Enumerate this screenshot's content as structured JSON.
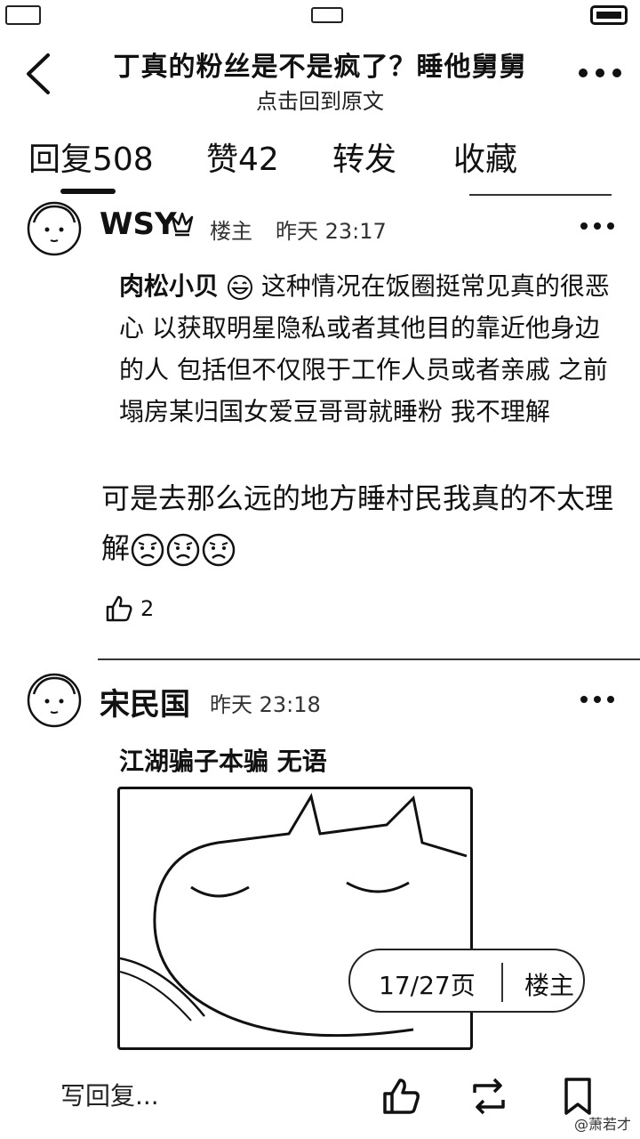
{
  "header": {
    "title": "丁真的粉丝是不是疯了？睡他舅舅",
    "subtitle": "点击回到原文"
  },
  "tabs": [
    {
      "label": "回复508"
    },
    {
      "label": "赞42"
    },
    {
      "label": "转发"
    },
    {
      "label": "收藏"
    }
  ],
  "post1": {
    "username": "WSY",
    "role": "楼主",
    "time": "昨天 23:17",
    "quote_name": "肉松小贝",
    "quote_text": " 这种情况在饭圈挺常见真的很恶心 以获取明星隐私或者其他目的靠近他身边的人 包括但不仅限于工作人员或者亲戚 之前塌房某归国女爱豆哥哥就睡粉 我不理解",
    "reply_text": "可是去那么远的地方睡村民我真的不太理解",
    "likes": "2"
  },
  "post2": {
    "username": "宋民国",
    "time": "昨天 23:18",
    "quote_text": "江湖骗子本骗 无语"
  },
  "pager": {
    "page": "17/27页",
    "owner": "楼主"
  },
  "bottom": {
    "reply_placeholder": "写回复..."
  },
  "watermark": "@萧若才",
  "icons": [
    "back-icon",
    "more-icon",
    "crown-icon",
    "grin-emoji",
    "sad-emoji",
    "thumbs-up-icon",
    "retweet-icon",
    "bookmark-icon"
  ]
}
